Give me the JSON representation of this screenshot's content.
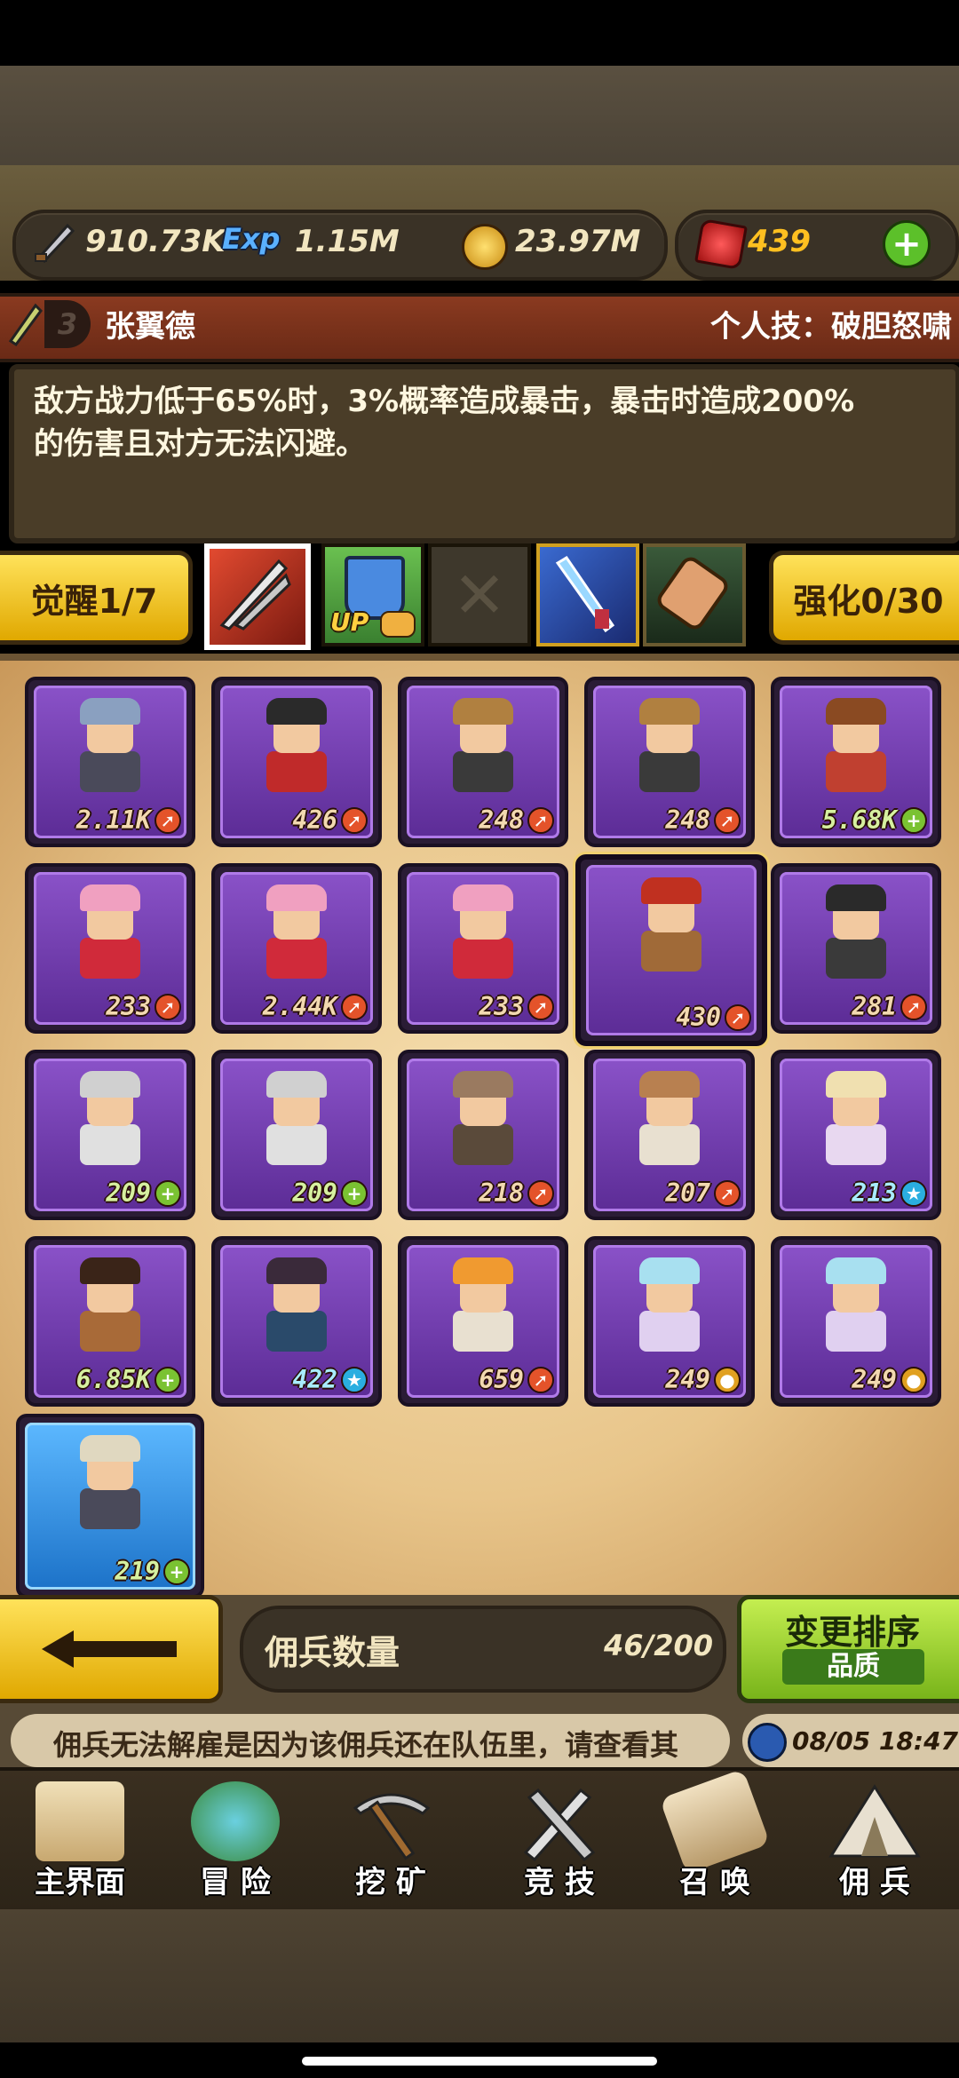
{
  "currency": {
    "attack": "910.73K",
    "exp_label": "Exp",
    "exp": "1.15M",
    "gold": "23.97M",
    "gems": "439"
  },
  "hero": {
    "rank": "3",
    "name": "张翼德",
    "skill_label": "个人技：破胆怒啸",
    "description_line1": "敌方战力低于65%时，3%概率造成暴击，暴击时造成200%",
    "description_line2": "的伤害且对方无法闪避。"
  },
  "awaken_button": "觉醒1/7",
  "enhance_button": "强化0/30",
  "skill_slots": [
    {
      "name": "sword-skill",
      "selected": true
    },
    {
      "name": "shield-up-skill",
      "badge": "UP"
    },
    {
      "name": "locked-skill"
    },
    {
      "name": "spear-skill"
    },
    {
      "name": "scroll-skill"
    }
  ],
  "mercenaries": [
    {
      "level": "2.11K",
      "badge": "arrow",
      "hair": "#8aa0c0",
      "body": "#4a4a5a"
    },
    {
      "level": "426",
      "badge": "arrow",
      "hair": "#2a2a2a",
      "body": "#c02a2a"
    },
    {
      "level": "248",
      "badge": "arrow",
      "hair": "#b08040",
      "body": "#3a3a3a"
    },
    {
      "level": "248",
      "badge": "arrow",
      "hair": "#b08040",
      "body": "#3a3a3a"
    },
    {
      "level": "5.68K",
      "badge": "plus",
      "hair": "#8a4a22",
      "body": "#c04030"
    },
    {
      "level": "233",
      "badge": "arrow",
      "hair": "#f0a0c0",
      "body": "#d02a3a"
    },
    {
      "level": "2.44K",
      "badge": "arrow",
      "hair": "#f0a0c0",
      "body": "#d02a3a"
    },
    {
      "level": "233",
      "badge": "arrow",
      "hair": "#f0a0c0",
      "body": "#d02a3a"
    },
    {
      "level": "430",
      "badge": "arrow",
      "hair": "#c03020",
      "body": "#a06a38",
      "selected": true
    },
    {
      "level": "281",
      "badge": "arrow",
      "hair": "#2a2a2a",
      "body": "#3a3a3a"
    },
    {
      "level": "209",
      "badge": "plus",
      "hair": "#d0d0d0",
      "body": "#e0e0e0"
    },
    {
      "level": "209",
      "badge": "plus",
      "hair": "#d0d0d0",
      "body": "#e0e0e0"
    },
    {
      "level": "218",
      "badge": "arrow",
      "hair": "#9a7a60",
      "body": "#5a4a3a"
    },
    {
      "level": "207",
      "badge": "arrow",
      "hair": "#b88050",
      "body": "#e8e0d0"
    },
    {
      "level": "213",
      "badge": "star",
      "hair": "#f0e0b0",
      "body": "#e8d8f0"
    },
    {
      "level": "6.85K",
      "badge": "plus",
      "hair": "#3a2418",
      "body": "#a86a38"
    },
    {
      "level": "422",
      "badge": "star",
      "hair": "#3a2a3a",
      "body": "#2a4a6a"
    },
    {
      "level": "659",
      "badge": "arrow",
      "hair": "#f09a30",
      "body": "#e8e0d0"
    },
    {
      "level": "249",
      "badge": "gold",
      "hair": "#a8e0f0",
      "body": "#e0d0f0"
    },
    {
      "level": "249",
      "badge": "gold",
      "hair": "#a8e0f0",
      "body": "#e0d0f0"
    },
    {
      "level": "219",
      "badge": "plus",
      "hair": "#e0d8c0",
      "body": "#4a4a5a",
      "blue": true
    }
  ],
  "count": {
    "label": "佣兵数量",
    "value": "46/200"
  },
  "sort": {
    "label": "变更排序",
    "mode": "品质"
  },
  "tip": "佣兵无法解雇是因为该佣兵还在队伍里，请查看其",
  "time": "08/05 18:47",
  "nav": [
    {
      "label": "主界面"
    },
    {
      "label": "冒 险"
    },
    {
      "label": "挖 矿"
    },
    {
      "label": "竞 技"
    },
    {
      "label": "召 唤"
    },
    {
      "label": "佣 兵"
    }
  ]
}
